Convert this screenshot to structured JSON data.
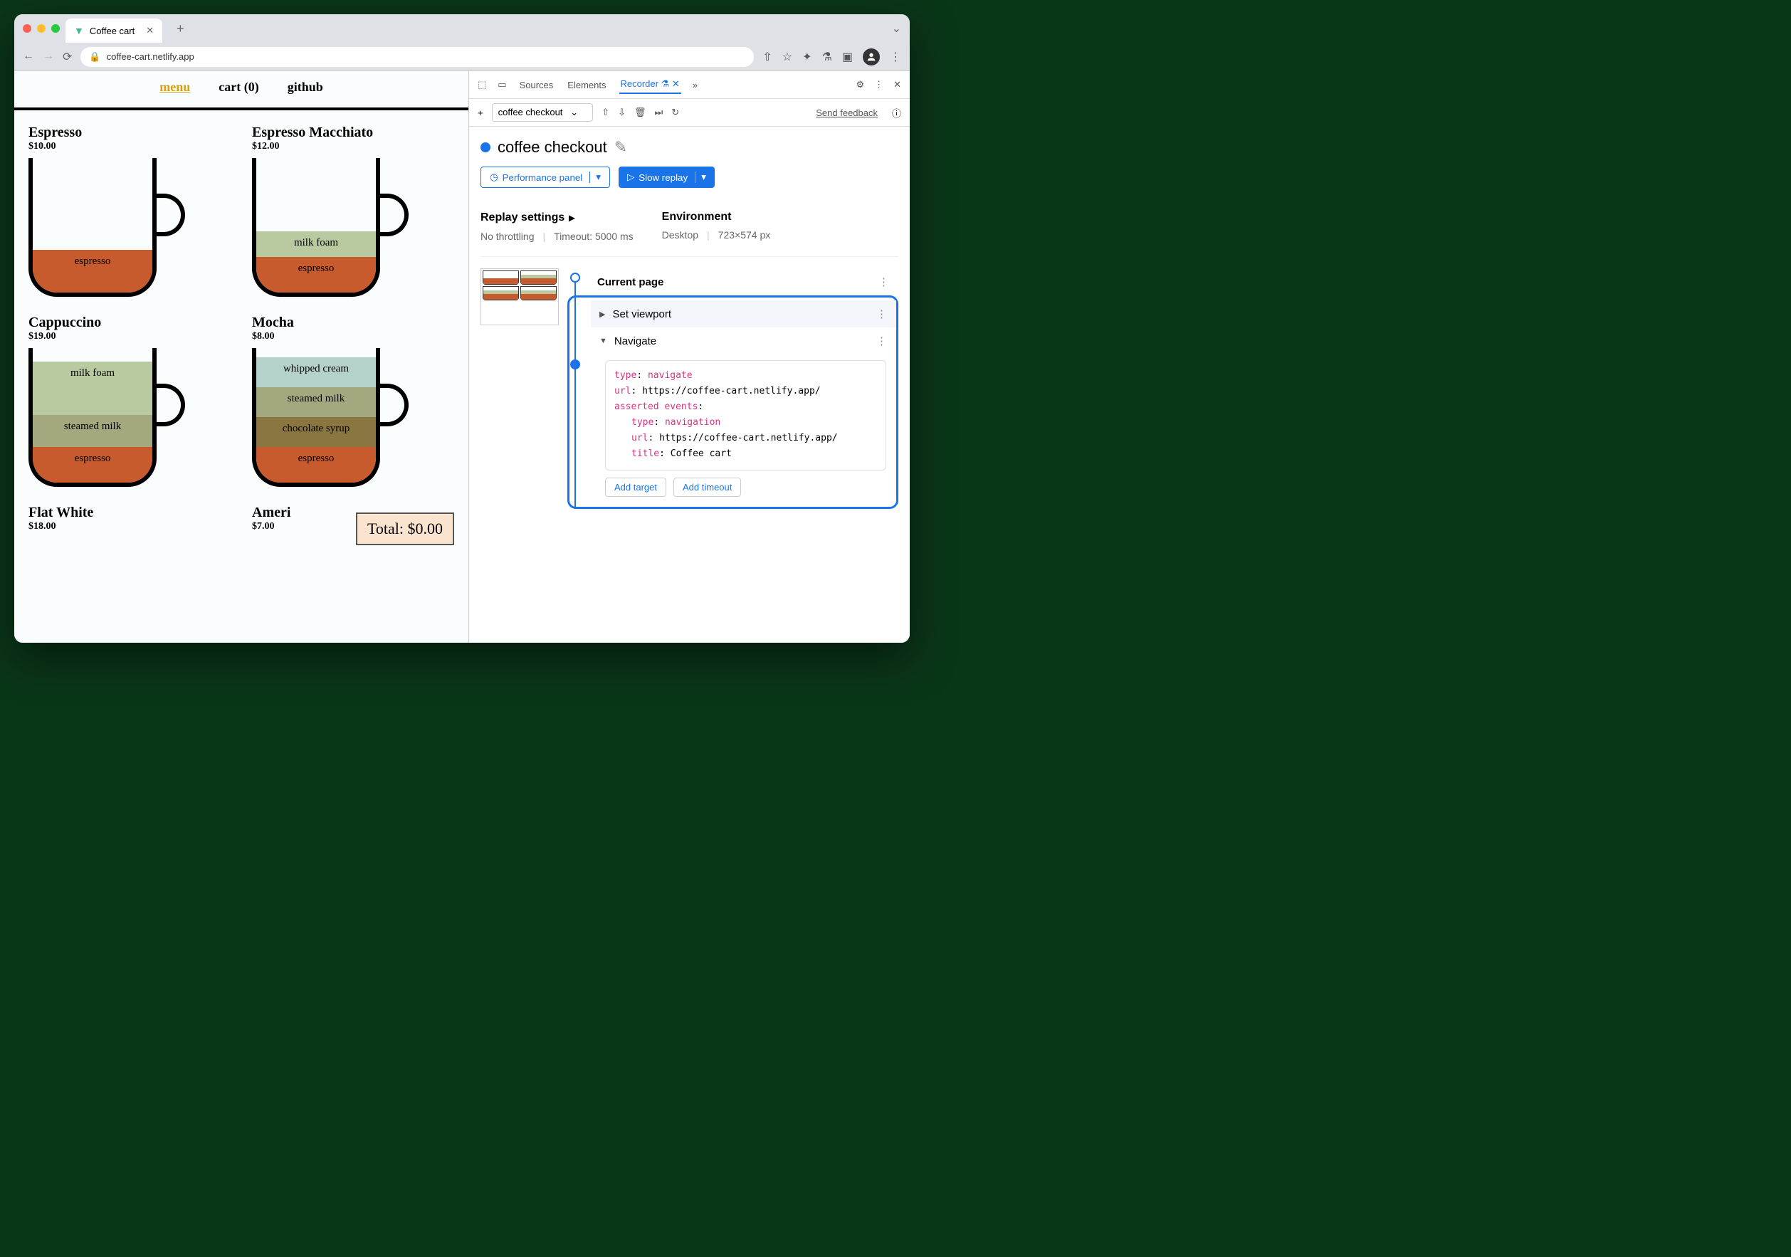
{
  "tab": {
    "title": "Coffee cart"
  },
  "url": "coffee-cart.netlify.app",
  "app_nav": {
    "menu": "menu",
    "cart": "cart (0)",
    "github": "github"
  },
  "coffees": [
    {
      "name": "Espresso",
      "price": "$10.00"
    },
    {
      "name": "Espresso Macchiato",
      "price": "$12.00"
    },
    {
      "name": "Cappuccino",
      "price": "$19.00"
    },
    {
      "name": "Mocha",
      "price": "$8.00"
    },
    {
      "name": "Flat White",
      "price": "$18.00"
    },
    {
      "name": "Americano",
      "price": "$7.00"
    }
  ],
  "layers": {
    "espresso": "espresso",
    "milkfoam": "milk foam",
    "steamedmilk": "steamed milk",
    "whipped": "whipped cream",
    "chocsyrup": "chocolate syrup"
  },
  "total": "Total: $0.00",
  "devtools": {
    "tabs": {
      "sources": "Sources",
      "elements": "Elements",
      "recorder": "Recorder"
    },
    "recording_select": "coffee checkout",
    "feedback": "Send feedback",
    "title": "coffee checkout",
    "perf_btn": "Performance panel",
    "replay_btn": "Slow replay",
    "replay_settings_h": "Replay settings",
    "no_throttling": "No throttling",
    "timeout": "Timeout: 5000 ms",
    "env_h": "Environment",
    "env_device": "Desktop",
    "env_size": "723×574 px",
    "step_current": "Current page",
    "step_viewport": "Set viewport",
    "step_navigate": "Navigate",
    "nav_details": {
      "type_k": "type",
      "type_v": "navigate",
      "url_k": "url",
      "url_v": "https://coffee-cart.netlify.app/",
      "asserted_k": "asserted events",
      "a_type_k": "type",
      "a_type_v": "navigation",
      "a_url_k": "url",
      "a_url_v": "https://coffee-cart.netlify.app/",
      "a_title_k": "title",
      "a_title_v": "Coffee cart"
    },
    "add_target": "Add target",
    "add_timeout": "Add timeout"
  }
}
